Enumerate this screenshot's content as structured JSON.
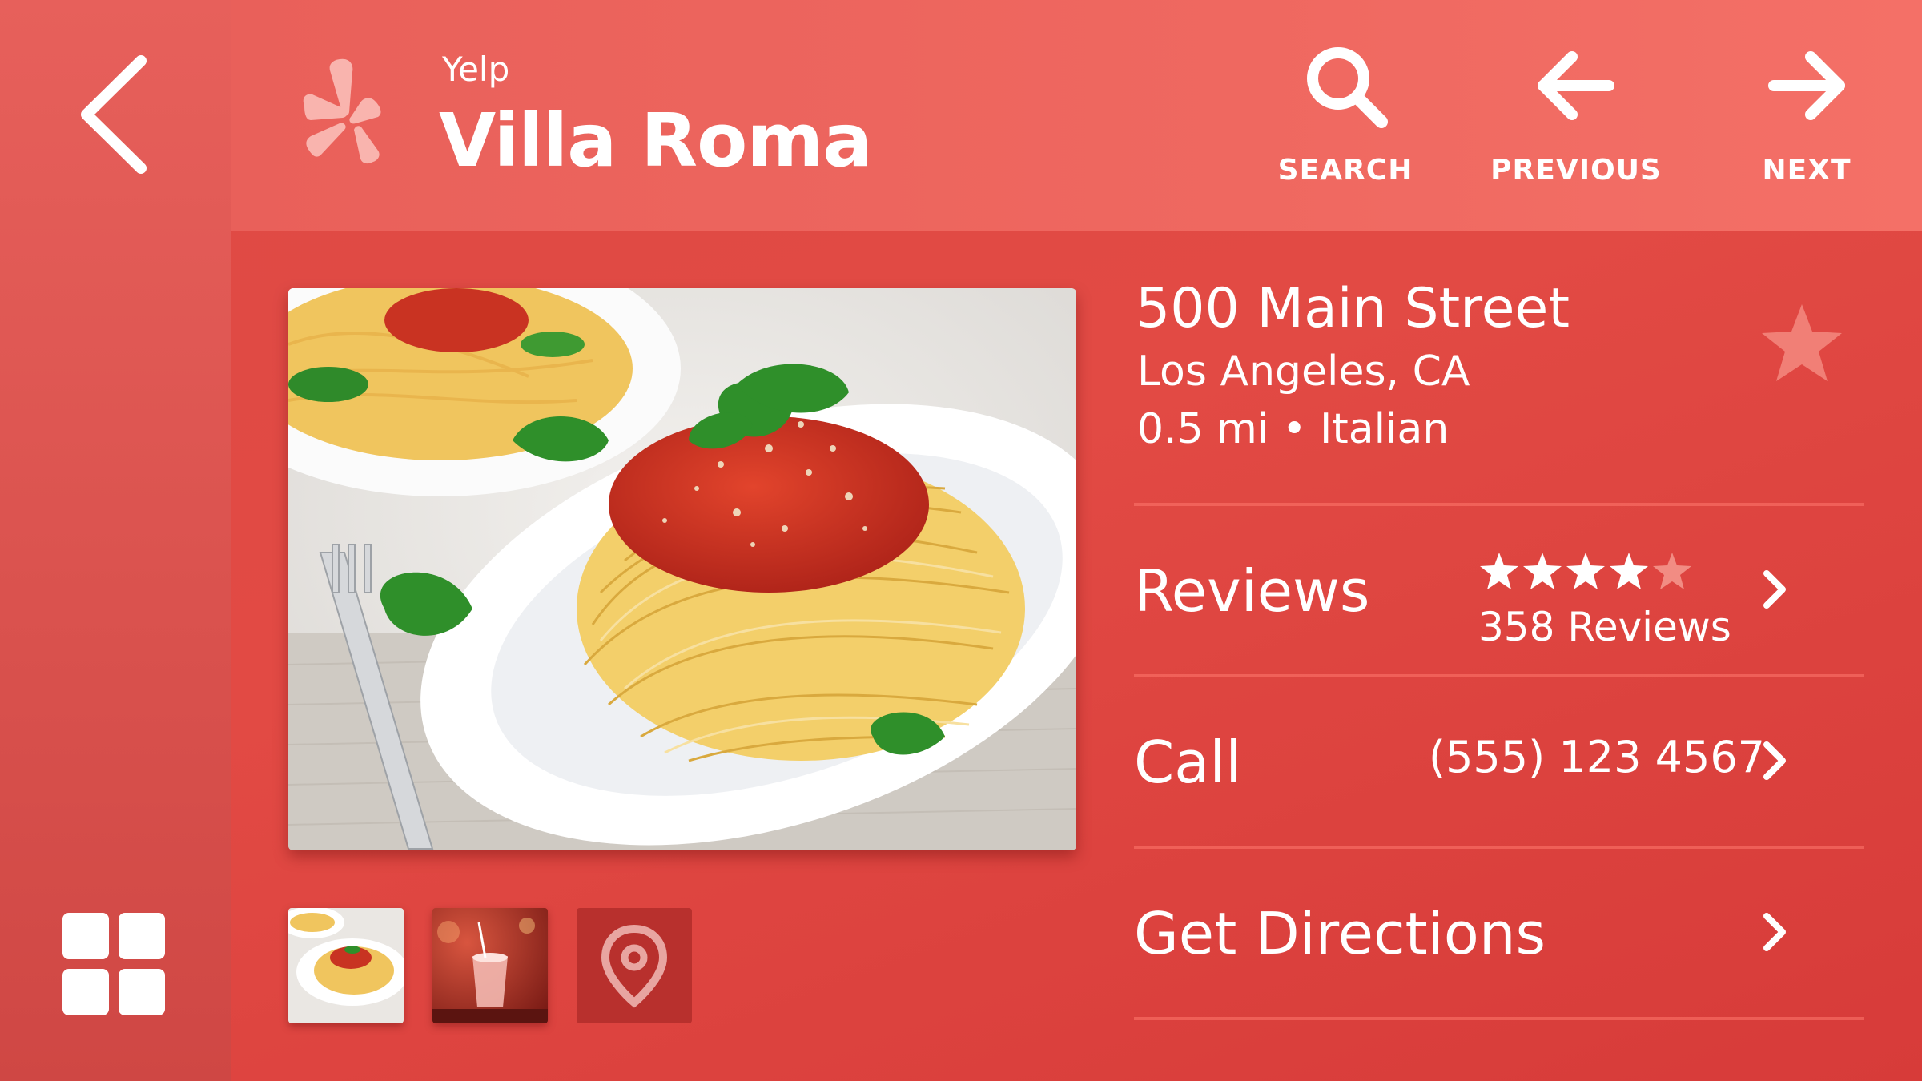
{
  "app": {
    "name": "Yelp",
    "accent": "#e24a44"
  },
  "business": {
    "name": "Villa Roma",
    "address_line1": "500 Main Street",
    "address_line2": "Los Angeles, CA",
    "distance_category": "0.5 mi • Italian"
  },
  "header": {
    "actions": [
      {
        "label": "SEARCH",
        "icon": "search-icon"
      },
      {
        "label": "PREVIOUS",
        "icon": "arrow-left-icon"
      },
      {
        "label": "NEXT",
        "icon": "arrow-right-icon"
      }
    ]
  },
  "rows": {
    "reviews": {
      "label": "Reviews",
      "rating": 4.5,
      "count_text": "358 Reviews"
    },
    "call": {
      "label": "Call",
      "phone": "(555) 123 4567"
    },
    "directions": {
      "label": "Get Directions"
    }
  },
  "sidebar": {
    "back_icon": "chevron-left-icon",
    "apps_icon": "grid-icon"
  },
  "thumbnails": [
    "pasta-photo",
    "drink-photo",
    "map-pin-icon"
  ]
}
